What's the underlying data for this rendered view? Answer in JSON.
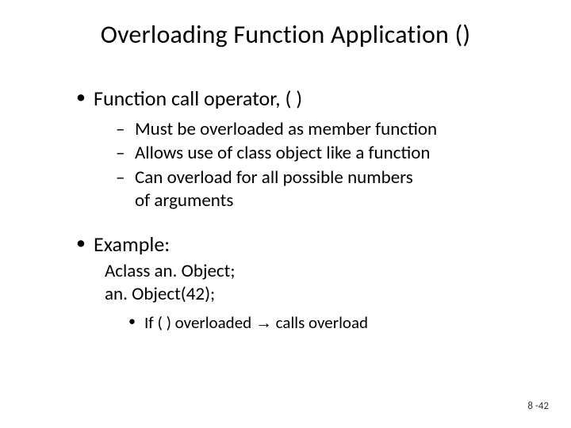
{
  "title": "Overloading Function Application ()",
  "bullets": {
    "item1": "Function call operator, ( )",
    "sub1": "Must be overloaded as member function",
    "sub2": "Allows use of class object like a function",
    "sub3a": "Can overload for all possible numbers",
    "sub3b": "of arguments",
    "item2": "Example:",
    "code1": "Aclass an. Object;",
    "code2": "an. Object(42);",
    "sub4a": "If ( ) overloaded ",
    "sub4arrow": "→",
    "sub4b": " calls overload"
  },
  "footer": "8 -42"
}
